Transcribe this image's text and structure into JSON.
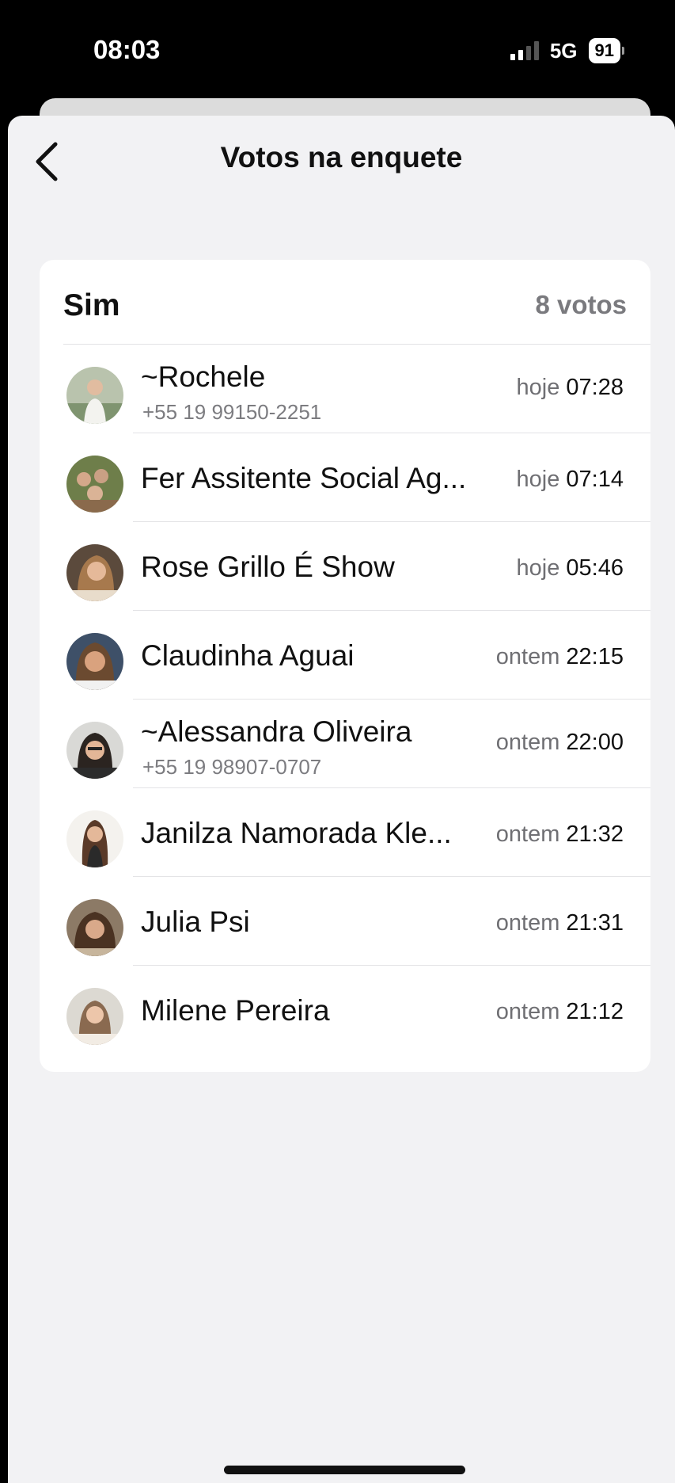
{
  "status": {
    "time": "08:03",
    "network": "5G",
    "battery": "91"
  },
  "nav": {
    "title": "Votos na enquete"
  },
  "option": {
    "label": "Sim",
    "count": "8 votos"
  },
  "voters": [
    {
      "name": "~Rochele",
      "phone": "+55 19 99150-2251",
      "day": "hoje",
      "time": "07:28"
    },
    {
      "name": "Fer Assitente Social  Ag...",
      "phone": "",
      "day": "hoje",
      "time": "07:14"
    },
    {
      "name": "Rose Grillo É Show",
      "phone": "",
      "day": "hoje",
      "time": "05:46"
    },
    {
      "name": "Claudinha Aguai",
      "phone": "",
      "day": "ontem",
      "time": "22:15"
    },
    {
      "name": "~Alessandra Oliveira",
      "phone": "+55 19 98907-0707",
      "day": "ontem",
      "time": "22:00"
    },
    {
      "name": "Janilza Namorada Kle...",
      "phone": "",
      "day": "ontem",
      "time": "21:32"
    },
    {
      "name": "Julia Psi",
      "phone": "",
      "day": "ontem",
      "time": "21:31"
    },
    {
      "name": "Milene Pereira",
      "phone": "",
      "day": "ontem",
      "time": "21:12"
    }
  ]
}
